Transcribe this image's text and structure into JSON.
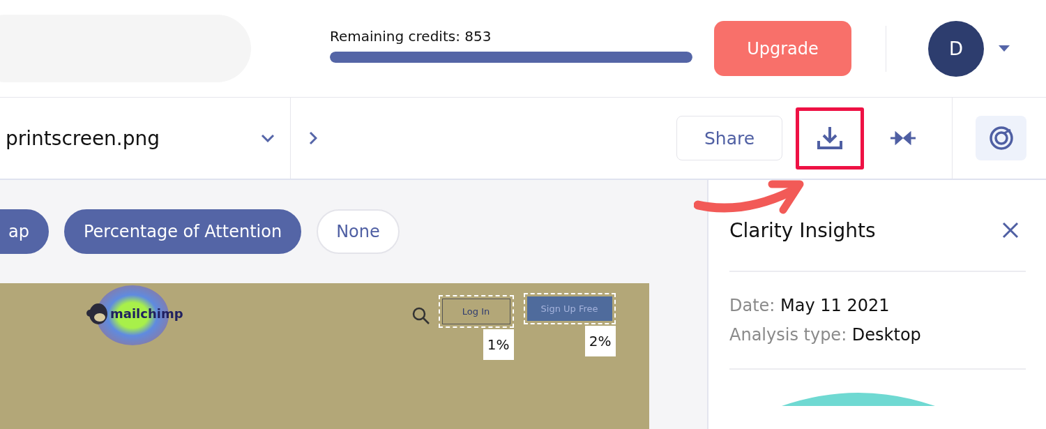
{
  "credits": {
    "label": "Remaining credits: 853",
    "level": 1
  },
  "upgrade_button": "Upgrade",
  "avatar": {
    "initial": "D"
  },
  "file": {
    "name": "printscreen.png"
  },
  "share_button": "Share",
  "view_modes": [
    {
      "label": "ap",
      "selected": true
    },
    {
      "label": "Percentage of Attention",
      "selected": true
    },
    {
      "label": "None",
      "selected": false
    }
  ],
  "preview": {
    "logo": "mailchimp",
    "buttons": [
      {
        "label": "Log In",
        "kind": "outline",
        "attention": "1%"
      },
      {
        "label": "Sign Up Free",
        "kind": "filled",
        "attention": "2%"
      }
    ]
  },
  "insights": {
    "title": "Clarity Insights",
    "details": [
      {
        "label": "Date:",
        "value": "May 11 2021"
      },
      {
        "label": "Analysis type:",
        "value": "Desktop"
      }
    ]
  }
}
